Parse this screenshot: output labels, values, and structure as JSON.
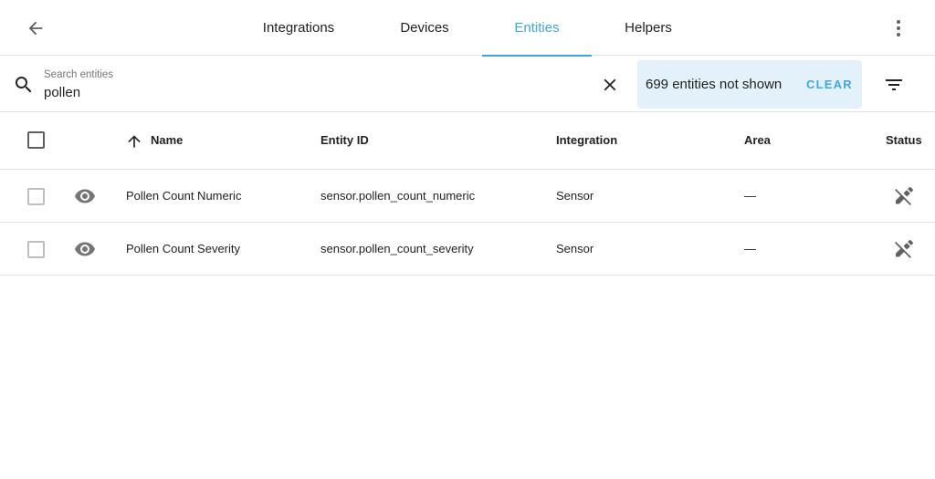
{
  "topbar": {
    "back_icon": "arrow-left-icon",
    "tabs": [
      {
        "label": "Integrations"
      },
      {
        "label": "Devices"
      },
      {
        "label": "Entities"
      },
      {
        "label": "Helpers"
      }
    ],
    "active_tab": "Entities",
    "menu_icon": "dots-vertical-icon"
  },
  "search": {
    "label": "Search entities",
    "value": "pollen",
    "clear_icon": "close-icon"
  },
  "filter_banner": {
    "text": "699 entities not shown",
    "clear_label": "CLEAR"
  },
  "filter_icon": "filter-icon",
  "table": {
    "columns": {
      "name": "Name",
      "entity_id": "Entity ID",
      "integration": "Integration",
      "area": "Area",
      "status": "Status"
    },
    "sort_icon": "arrow-up-icon",
    "rows": [
      {
        "name": "Pollen Count Numeric",
        "entity_id": "sensor.pollen_count_numeric",
        "integration": "Sensor",
        "area": "—",
        "status_icon": "pencil-off-icon"
      },
      {
        "name": "Pollen Count Severity",
        "entity_id": "sensor.pollen_count_severity",
        "integration": "Sensor",
        "area": "—",
        "status_icon": "pencil-off-icon"
      }
    ]
  },
  "colors": {
    "accent": "#3fa7e2",
    "banner_bg": "#e3f1fb",
    "divider": "#e0e0e0"
  }
}
